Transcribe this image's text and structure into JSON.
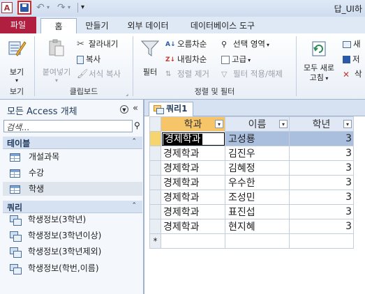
{
  "window": {
    "app_icon_letter": "A",
    "title": "답_UI하"
  },
  "quick_access": {
    "more": "▾"
  },
  "tabs": {
    "file": "파일",
    "home": "홈",
    "create": "만들기",
    "external_data": "외부 데이터",
    "database_tools": "데이터베이스 도구"
  },
  "ribbon": {
    "views": {
      "view_label": "보기",
      "group_label": "보기"
    },
    "clipboard": {
      "paste_label": "붙여넣기",
      "cut_label": "잘라내기",
      "copy_label": "복사",
      "format_painter_label": "서식 복사",
      "group_label": "클립보드"
    },
    "sort_filter": {
      "filter_label": "필터",
      "ascending_label": "오름차순",
      "descending_label": "내림차순",
      "remove_sort_label": "정렬 제거",
      "selection_label": "선택 영역",
      "advanced_label": "고급",
      "toggle_filter_label": "필터 적용/해제",
      "group_label": "정렬 및 필터"
    },
    "records": {
      "refresh_line1": "모두 새로",
      "refresh_line2": "고침",
      "new_label": "새",
      "save_label": "저",
      "delete_label": "삭"
    }
  },
  "navigation": {
    "title": "모든 Access 개체",
    "search_placeholder": "검색...",
    "sections": [
      {
        "label": "테이블",
        "items": [
          "개설과목",
          "수강",
          "학생"
        ]
      },
      {
        "label": "쿼리",
        "items": [
          "학생정보(3학년)",
          "학생정보(3학년이상)",
          "학생정보(3학년제외)",
          "학생정보(학번,이름)"
        ]
      }
    ]
  },
  "document": {
    "tab_label": "쿼리1",
    "columns": [
      "학과",
      "이름",
      "학년"
    ],
    "rows": [
      [
        "경제학과",
        "고성룡",
        "3"
      ],
      [
        "경제학과",
        "김진우",
        "3"
      ],
      [
        "경제학과",
        "김혜정",
        "3"
      ],
      [
        "경제학과",
        "우수한",
        "3"
      ],
      [
        "경제학과",
        "조성민",
        "3"
      ],
      [
        "경제학과",
        "표진섭",
        "3"
      ],
      [
        "경제학과",
        "현지혜",
        "3"
      ]
    ],
    "new_row_marker": "*"
  }
}
